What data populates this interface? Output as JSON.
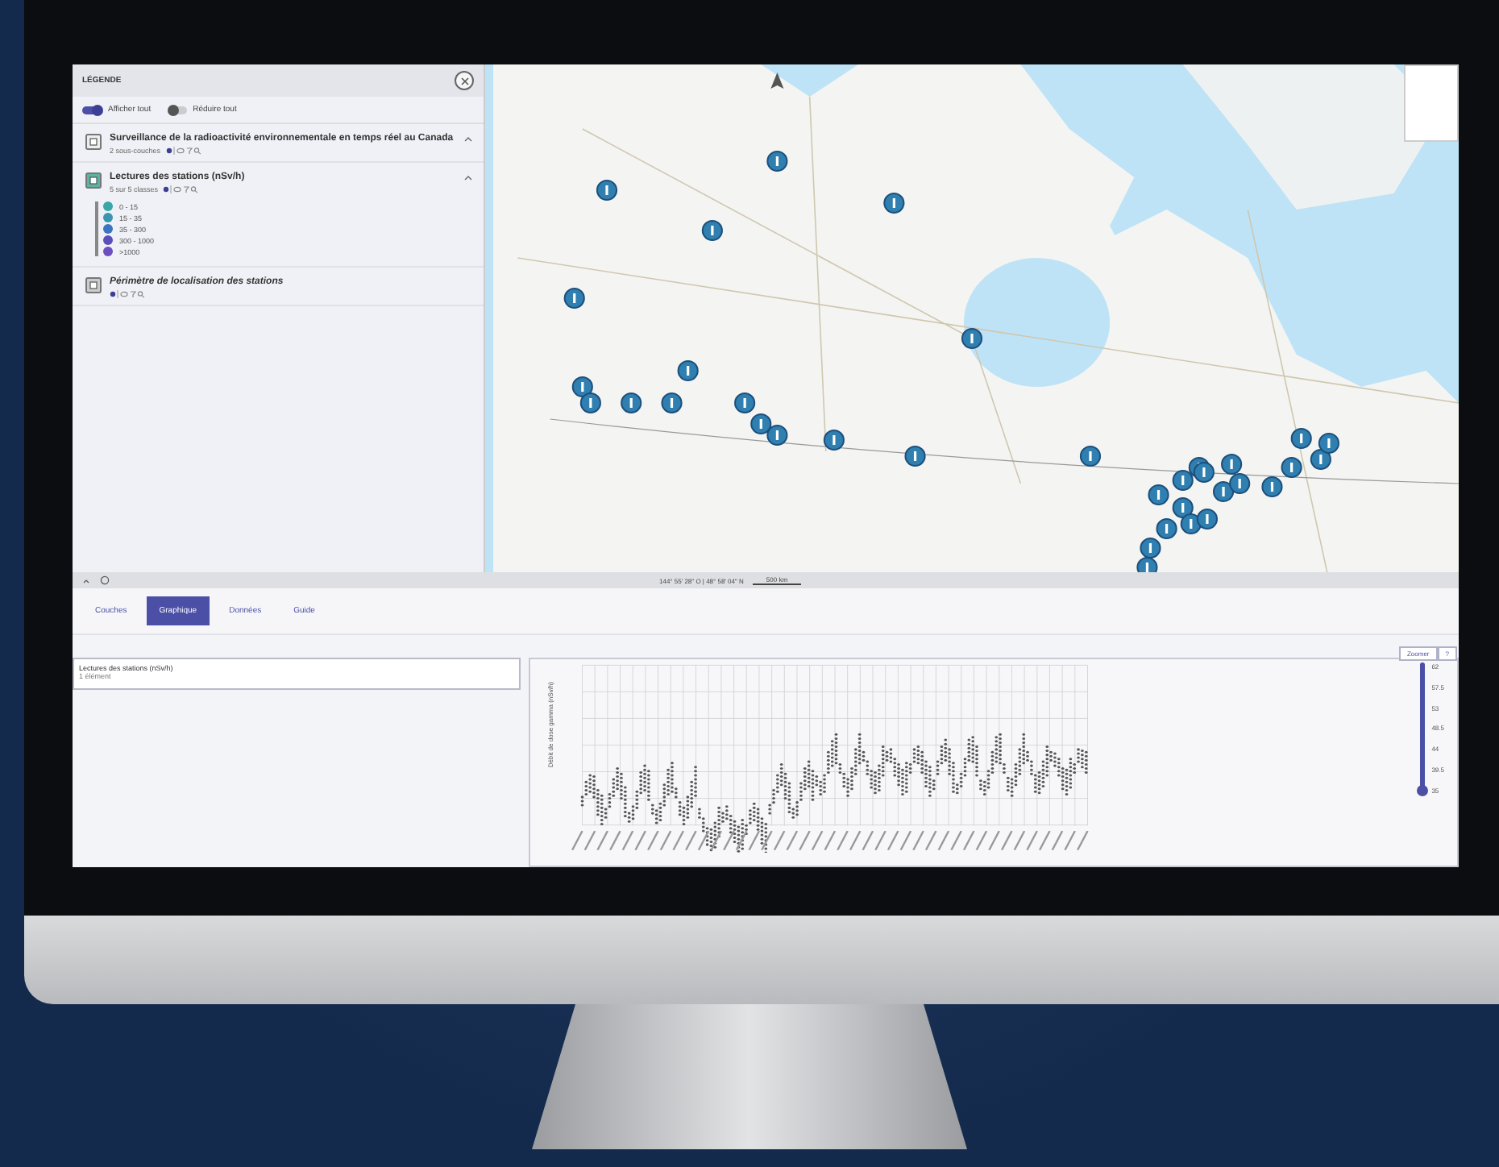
{
  "legend": {
    "title": "LÉGENDE",
    "toggles": [
      {
        "label": "Afficher tout",
        "on": true
      },
      {
        "label": "Réduire tout",
        "on": false
      }
    ],
    "groups": [
      {
        "kind": "group",
        "title": "Surveillance de la radioactivité environnementale en temps réel au Canada",
        "subtitle": "2 sous-couches",
        "expanded": true
      },
      {
        "kind": "layer",
        "title": "Lectures des stations (nSv/h)",
        "subtitle": "5 sur 5 classes",
        "expanded": true,
        "classes": [
          {
            "label": "0 - 15",
            "color": "#3aa6a8"
          },
          {
            "label": "15 - 35",
            "color": "#3a95b0"
          },
          {
            "label": "35 - 300",
            "color": "#3b74c0"
          },
          {
            "label": "300 - 1000",
            "color": "#5a4fb8"
          },
          {
            "label": ">1000",
            "color": "#6b4fc0"
          }
        ]
      },
      {
        "kind": "boundary",
        "title": "Périmètre de localisation des stations",
        "expanded": false
      }
    ]
  },
  "map": {
    "coordinates": "144° 55' 28\" O | 48° 58' 04\" N",
    "scale": "500 km"
  },
  "tabs": [
    {
      "label": "Couches",
      "selected": false
    },
    {
      "label": "Graphique",
      "selected": true
    },
    {
      "label": "Données",
      "selected": false
    },
    {
      "label": "Guide",
      "selected": false
    }
  ],
  "layer_card": {
    "title": "Lectures des stations (nSv/h)",
    "count": "1 élément"
  },
  "chart": {
    "ylabel": "Débit de dose gamma (nSv/h)",
    "zoom_button": "Zoomer",
    "help_button": "?",
    "slider": {
      "level": 1,
      "ticks": [
        "62",
        "57.5",
        "53",
        "48.5",
        "44",
        "39.5",
        "35"
      ]
    }
  }
}
